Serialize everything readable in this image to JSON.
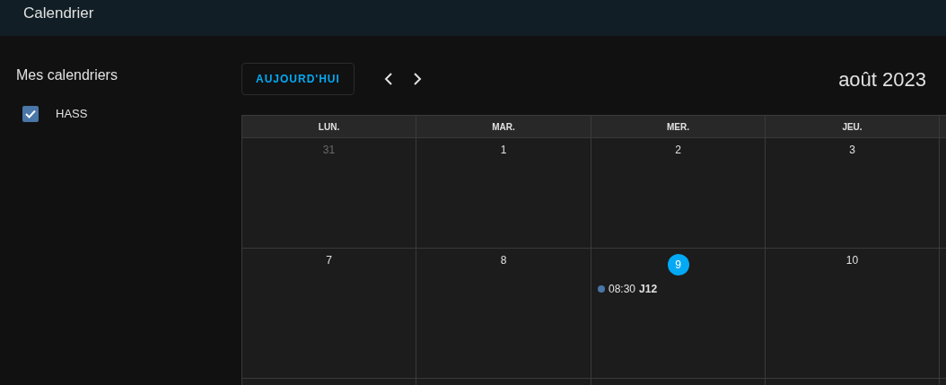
{
  "header": {
    "title": "Calendrier"
  },
  "sidebar": {
    "title": "Mes calendriers",
    "calendars": [
      {
        "name": "HASS",
        "checked": true,
        "color": "#4a76a8"
      }
    ]
  },
  "toolbar": {
    "today_button": "AUJOURD'HUI",
    "period": "août 2023"
  },
  "weekdays": [
    "LUN.",
    "MAR.",
    "MER.",
    "JEU."
  ],
  "weeks": [
    {
      "days": [
        {
          "label": "31",
          "outside": true,
          "today": false
        },
        {
          "label": "1",
          "outside": false,
          "today": false
        },
        {
          "label": "2",
          "outside": false,
          "today": false
        },
        {
          "label": "3",
          "outside": false,
          "today": false
        }
      ]
    },
    {
      "days": [
        {
          "label": "7",
          "outside": false,
          "today": false
        },
        {
          "label": "8",
          "outside": false,
          "today": false
        },
        {
          "label": "9",
          "outside": false,
          "today": true,
          "events": [
            {
              "time": "08:30",
              "title": "J12",
              "color": "#4a76a8"
            }
          ]
        },
        {
          "label": "10",
          "outside": false,
          "today": false
        }
      ]
    }
  ]
}
